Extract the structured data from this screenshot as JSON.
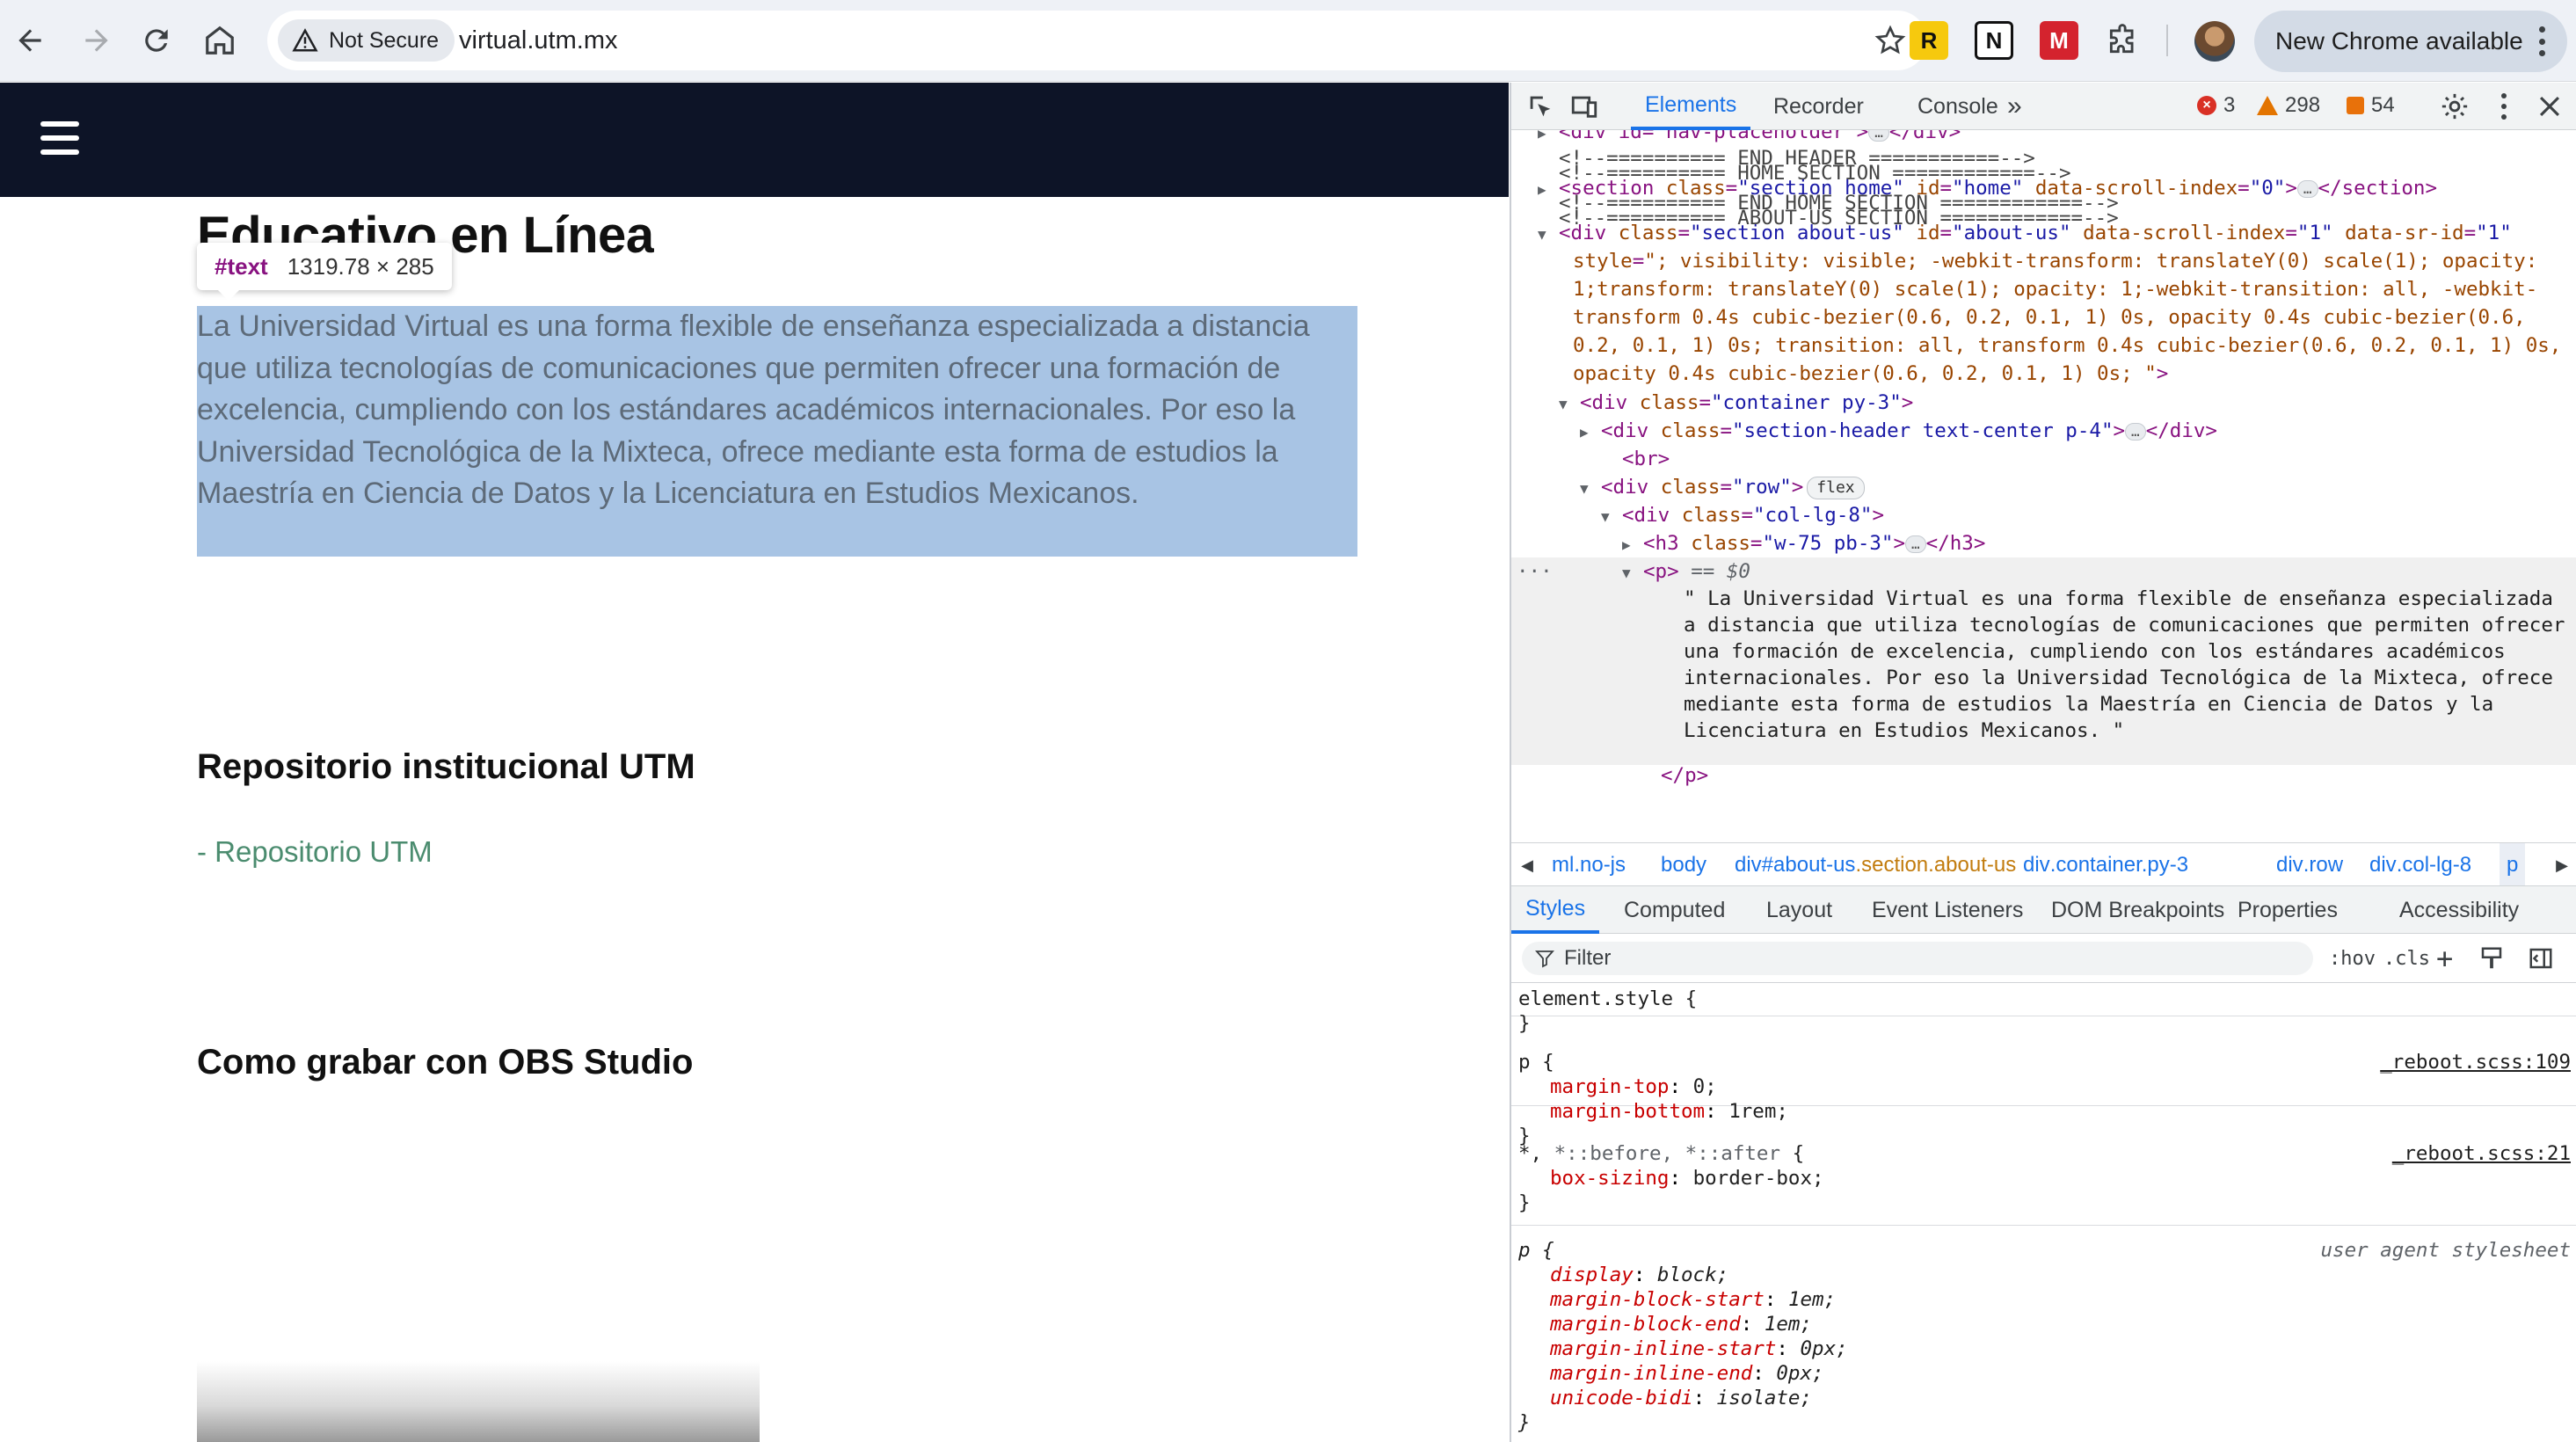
{
  "browser": {
    "security_label": "Not Secure",
    "url": "virtual.utm.mx",
    "update_label": "New Chrome available",
    "extensions": [
      {
        "name": "readwise-extension-icon",
        "glyph": "R",
        "bg": "#f6c90e",
        "fg": "#111111"
      },
      {
        "name": "notion-extension-icon",
        "glyph": "N",
        "bg": "#ffffff",
        "fg": "#111111"
      },
      {
        "name": "mendeley-extension-icon",
        "glyph": "M",
        "bg": "#d4232e",
        "fg": "#ffffff"
      },
      {
        "name": "puzzle-extensions-icon",
        "glyph": "",
        "bg": "transparent",
        "fg": "#3c4043"
      }
    ]
  },
  "page": {
    "heading_partial": "Educativo en Línea",
    "tooltip": {
      "tag": "#text",
      "size": "1319.78 × 285"
    },
    "about_text": "La Universidad Virtual es una forma flexible de enseñanza especializada a distancia que utiliza tecnologías de comunicaciones que permiten ofrecer una formación de excelencia, cumpliendo con los estándares académicos internacionales. Por eso la Universidad Tecnológica de la Mixteca, ofrece mediante esta forma de estudios la Maestría en Ciencia de Datos y la Licenciatura en Estudios Mexicanos.",
    "repo_heading": "Repositorio institucional UTM",
    "repo_link": "- Repositorio UTM",
    "obs_heading": "Como grabar con OBS Studio"
  },
  "devtools": {
    "tabs": [
      "Elements",
      "Recorder",
      "Console"
    ],
    "more_tabs": "»",
    "errors": "3",
    "warnings": "298",
    "issues": "54",
    "dom": {
      "line0": "<div id=\"nav-placeholder\">",
      "c1": "<!--========== END HEADER ===========-->",
      "c2": "<!--========== HOME SECTION ============-->",
      "sec_tag": "section",
      "sec_class": "\"section home\"",
      "sec_id": "\"home\"",
      "sec_scroll": "\"0\"",
      "c3": "<!--========== END HOME SECTION ============-->",
      "c4": "<!--========== ABOUT-US SECTION ============-->",
      "about_class": "\"section about-us\"",
      "about_id": "\"about-us\"",
      "about_scroll": "\"1\"",
      "about_sr": "\"1\"",
      "about_style": "\"; visibility: visible;  -webkit-transform: translateY(0) scale(1); opacity: 1;transform: translateY(0) scale(1); opacity: 1;-webkit-transition: all, -webkit-transform 0.4s cubic-bezier(0.6, 0.2, 0.1, 1) 0s, opacity 0.4s cubic-bezier(0.6, 0.2, 0.1, 1) 0s; transition: all, transform 0.4s cubic-bezier(0.6, 0.2, 0.1, 1) 0s, opacity 0.4s cubic-bezier(0.6, 0.2, 0.1, 1) 0s; \"",
      "container_class": "\"container py-3\"",
      "header_class": "\"section-header text-center p-4\"",
      "br": "<br>",
      "row_class": "\"row\"",
      "flex_badge": "flex",
      "col_class": "\"col-lg-8\"",
      "h3_class": "\"w-75 pb-3\"",
      "p_open": "<p>",
      "p_marker": "== $0",
      "p_text": "\" La Universidad Virtual es una forma flexible de enseñanza especializada a distancia que utiliza tecnologías de comunicaciones que permiten ofrecer una formación de excelencia, cumpliendo con los estándares académicos internacionales. Por eso la Universidad Tecnológica de la Mixteca, ofrece mediante esta forma de estudios la Maestría en Ciencia de Datos y la Licenciatura en Estudios Mexicanos. \"",
      "p_close": "</p>"
    },
    "breadcrumbs": [
      {
        "tag": "ml.no-js",
        "cls": ""
      },
      {
        "tag": "body",
        "cls": ""
      },
      {
        "tag": "div#about-us",
        "cls": ".section.about-us"
      },
      {
        "tag": "div",
        "cls": ".container.py-3"
      },
      {
        "tag": "div",
        "cls": ".row"
      },
      {
        "tag": "div",
        "cls": ".col-lg-8"
      },
      {
        "tag": "p",
        "cls": ""
      }
    ],
    "subtabs": [
      "Styles",
      "Computed",
      "Layout",
      "Event Listeners",
      "DOM Breakpoints",
      "Properties",
      "Accessibility"
    ],
    "filter_placeholder": "Filter",
    "hov": ":hov",
    "cls": ".cls",
    "styles": {
      "element_style": "element.style {",
      "close": "}",
      "r1_selector": "p {",
      "r1_source": "_reboot.scss:109",
      "r1_p1_name": "margin-top",
      "r1_p1_val": "0;",
      "r1_p2_name": "margin-bottom",
      "r1_p2_val": "1rem;",
      "r2_selector_a": "*, ",
      "r2_selector_b": "*::before, *::after",
      "r2_selector_c": " {",
      "r2_source": "_reboot.scss:21",
      "r2_p1_name": "box-sizing",
      "r2_p1_val": "border-box;",
      "r3_selector": "p {",
      "r3_source": "user agent stylesheet",
      "r3_props": [
        {
          "name": "display",
          "val": "block;"
        },
        {
          "name": "margin-block-start",
          "val": "1em;"
        },
        {
          "name": "margin-block-end",
          "val": "1em;"
        },
        {
          "name": "margin-inline-start",
          "val": "0px;"
        },
        {
          "name": "margin-inline-end",
          "val": "0px;"
        },
        {
          "name": "unicode-bidi",
          "val": "isolate;"
        }
      ]
    }
  }
}
